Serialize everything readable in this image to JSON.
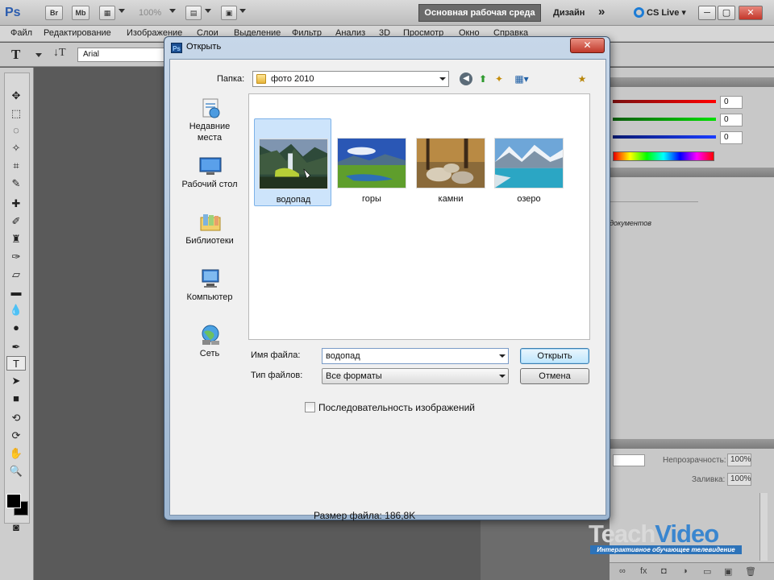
{
  "appbar": {
    "logo": "Ps",
    "bridge_label": "Br",
    "minibridge_label": "Mb",
    "zoom": "100%",
    "workspace_active": "Основная рабочая среда",
    "workspace_design": "Дизайн",
    "workspace_more": "»",
    "cslive": "CS Live",
    "minimize": "─",
    "restore": "▢",
    "close": "✕"
  },
  "menubar": {
    "items": [
      "Файл",
      "Редактирование",
      "Изображение",
      "Слои",
      "Выделение",
      "Фильтр",
      "Анализ",
      "3D",
      "Просмотр",
      "Окно",
      "Справка"
    ]
  },
  "options": {
    "tool_glyph": "T",
    "orientation_glyph": "↓T",
    "font": "Arial"
  },
  "panels": {
    "color_values": [
      "0",
      "0",
      "0"
    ],
    "doc_hint": "документов",
    "opacity_label": "Непрозрачность:",
    "opacity_value": "100%",
    "fill_label": "Заливка:",
    "fill_value": "100%",
    "bottom_icons": [
      "∞",
      "fx",
      "◘",
      "◑",
      "▭",
      "▣",
      "🗑"
    ]
  },
  "watermark": {
    "brand_a": "Teach",
    "brand_b": "Video",
    "tagline": "Интерактивное обучающее телевидение"
  },
  "dialog": {
    "icon": "Ps",
    "title": "Открыть",
    "close": "✕",
    "lookin_label": "Папка:",
    "lookin_value": "фото 2010",
    "places": [
      {
        "label": "Недавние места"
      },
      {
        "label": "Рабочий стол"
      },
      {
        "label": "Библиотеки"
      },
      {
        "label": "Компьютер"
      },
      {
        "label": "Сеть"
      }
    ],
    "files": [
      {
        "name": "водопад",
        "selected": true
      },
      {
        "name": "горы",
        "selected": false
      },
      {
        "name": "камни",
        "selected": false
      },
      {
        "name": "озеро",
        "selected": false
      }
    ],
    "filename_label": "Имя файла:",
    "filename_value": "водопад",
    "filetype_label": "Тип файлов:",
    "filetype_value": "Все форматы",
    "open_button": "Открыть",
    "cancel_button": "Отмена",
    "sequence_label": "Последовательность изображений",
    "sequence_checked": false,
    "filesize": "Размер файла: 186,8K"
  }
}
